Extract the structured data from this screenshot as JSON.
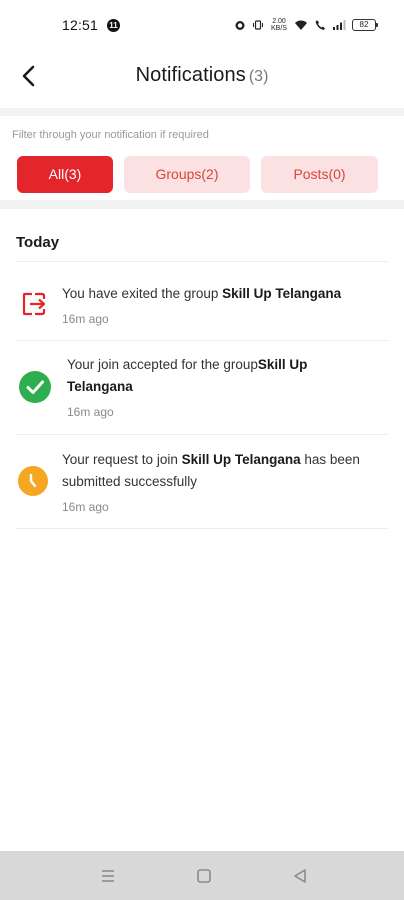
{
  "status_bar": {
    "time": "12:51",
    "notif_badge": "11",
    "net_speed": "2.00 KB/S",
    "battery": "82"
  },
  "header": {
    "title": "Notifications",
    "count": "(3)"
  },
  "filter": {
    "hint": "Filter through your notification if required",
    "chips": [
      {
        "label": "All(3)",
        "selected": true
      },
      {
        "label": "Groups(2)",
        "selected": false
      },
      {
        "label": "Posts(0)",
        "selected": false
      }
    ]
  },
  "section": {
    "title": "Today"
  },
  "notifications": [
    {
      "icon": "exit-icon",
      "text_before": "You have exited the group ",
      "bold": "Skill Up Telangana",
      "text_after": "",
      "time": "16m ago"
    },
    {
      "icon": "check-circle-icon",
      "text_before": "Your join accepted for the group",
      "bold": "Skill Up Telangana",
      "text_after": "",
      "time": "16m ago"
    },
    {
      "icon": "clock-icon",
      "text_before": "Your request to join ",
      "bold": "Skill Up Telangana",
      "text_after": " has been submitted successfully",
      "time": "16m ago"
    }
  ],
  "colors": {
    "accent": "#e3262b",
    "chip_inactive_bg": "#fbe1e2",
    "success": "#2fae4f",
    "pending": "#f5a623"
  }
}
